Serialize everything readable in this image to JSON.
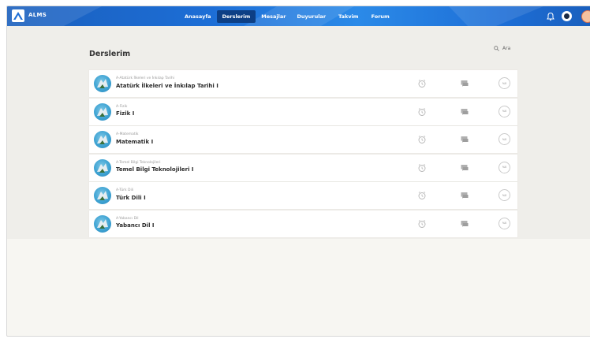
{
  "app": {
    "logo_text": "ALMS"
  },
  "nav": {
    "items": [
      {
        "label": "Anasayfa",
        "active": false
      },
      {
        "label": "Derslerim",
        "active": true
      },
      {
        "label": "Mesajlar",
        "active": false
      },
      {
        "label": "Duyurular",
        "active": false
      },
      {
        "label": "Takvim",
        "active": false
      },
      {
        "label": "Forum",
        "active": false
      }
    ]
  },
  "header_icons": [
    "bell-icon",
    "user-circle-icon",
    "profile-avatar"
  ],
  "page": {
    "title": "Derslerim"
  },
  "search": {
    "label": "Ara"
  },
  "courses": [
    {
      "subtitle": "A-Atatürk İlkeleri ve İnkılap Tarihi",
      "name": "Atatürk İlkeleri ve İnkılap Tarihi I",
      "grade": "%0"
    },
    {
      "subtitle": "A-Fizik",
      "name": "Fizik I",
      "grade": "%0"
    },
    {
      "subtitle": "A-Matematik",
      "name": "Matematik I",
      "grade": "%0"
    },
    {
      "subtitle": "A-Temel Bilgi Teknolojileri",
      "name": "Temel Bilgi Teknolojileri I",
      "grade": "%0"
    },
    {
      "subtitle": "A-Türk Dili",
      "name": "Türk Dili I",
      "grade": "%0"
    },
    {
      "subtitle": "A-Yabancı Dil",
      "name": "Yabancı Dil I",
      "grade": "%0"
    }
  ],
  "colors": {
    "topbar": "#1d6ed6",
    "nav_active": "#0d3f85",
    "content_bg": "#efeeea",
    "card_bg": "#ffffff"
  }
}
